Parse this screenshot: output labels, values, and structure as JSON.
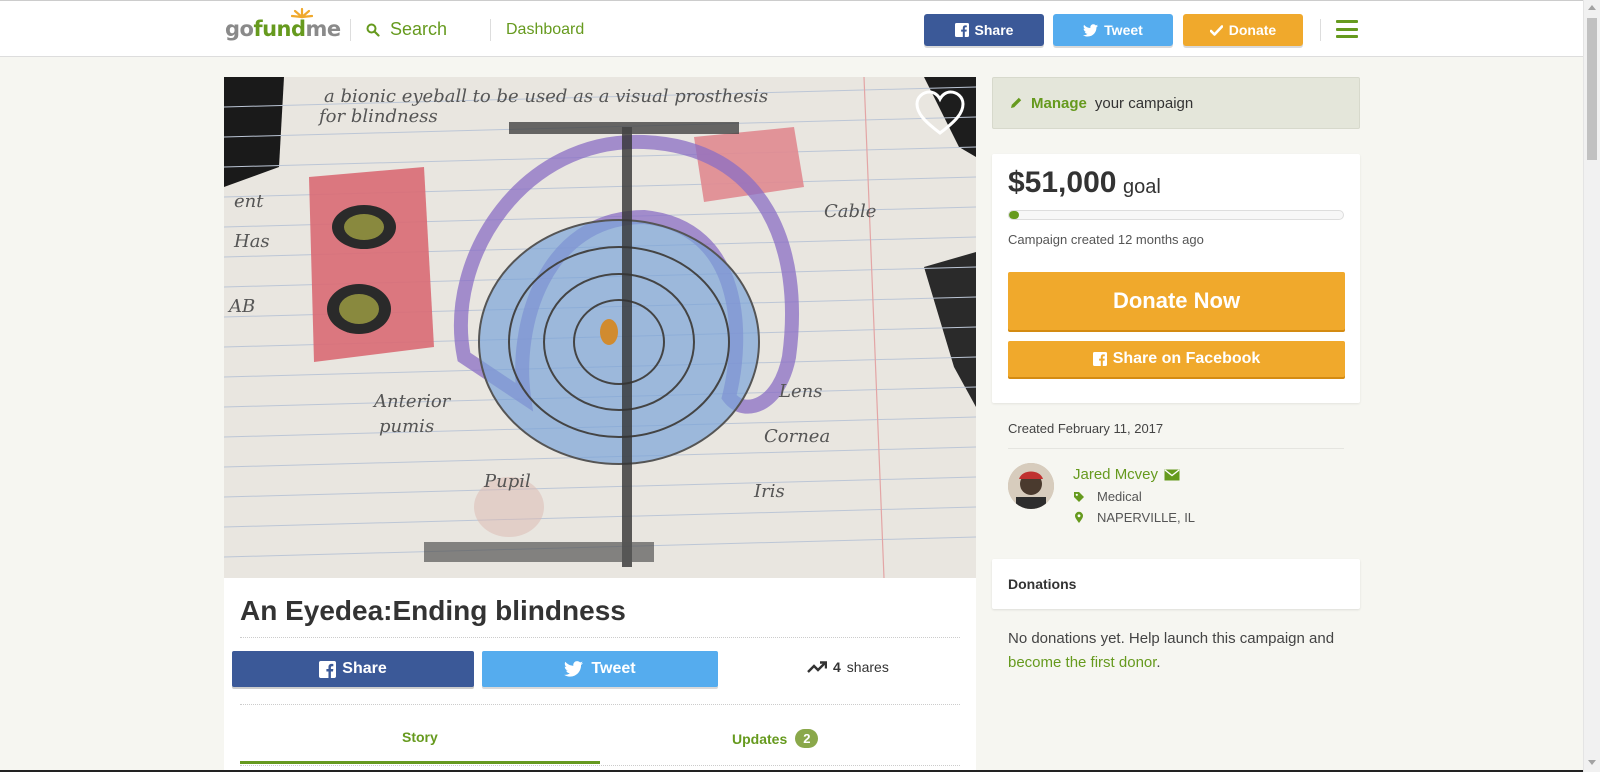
{
  "header": {
    "logo": {
      "go": "go",
      "fund": "fund",
      "me": "me"
    },
    "search_label": "Search",
    "dashboard_label": "Dashboard",
    "share_label": "Share",
    "tweet_label": "Tweet",
    "donate_label": "Donate"
  },
  "campaign": {
    "title": "An Eyedea:Ending blindness",
    "share_label": "Share",
    "tweet_label": "Tweet",
    "shares_count": "4",
    "shares_word": "shares",
    "tabs": [
      {
        "label": "Story"
      },
      {
        "label": "Updates",
        "badge": "2"
      }
    ]
  },
  "sidebar": {
    "manage_strong": "Manage",
    "manage_rest": "your campaign",
    "goal_amount": "$51,000",
    "goal_word": "goal",
    "progress_fraction": 0.01,
    "created_ago": "Campaign created 12 months ago",
    "donate_now_label": "Donate Now",
    "share_fb_label": "Share on Facebook",
    "created_date": "Created February 11, 2017",
    "organizer_name": "Jared Mcvey",
    "category": "Medical",
    "location": "NAPERVILLE, IL",
    "donations_header": "Donations",
    "no_donations_text": "No donations yet. Help launch this campaign and",
    "first_donor_link": "become the first donor",
    "first_donor_period": "."
  },
  "colors": {
    "brand_green": "#669a1e",
    "facebook": "#3b5998",
    "twitter": "#55acee",
    "donate_orange": "#f0a92c"
  },
  "icons": [
    "search-icon",
    "facebook-icon",
    "twitter-icon",
    "check-icon",
    "menu-icon",
    "heart-icon",
    "pencil-icon",
    "trending-icon",
    "envelope-icon",
    "tag-icon",
    "map-pin-icon"
  ]
}
